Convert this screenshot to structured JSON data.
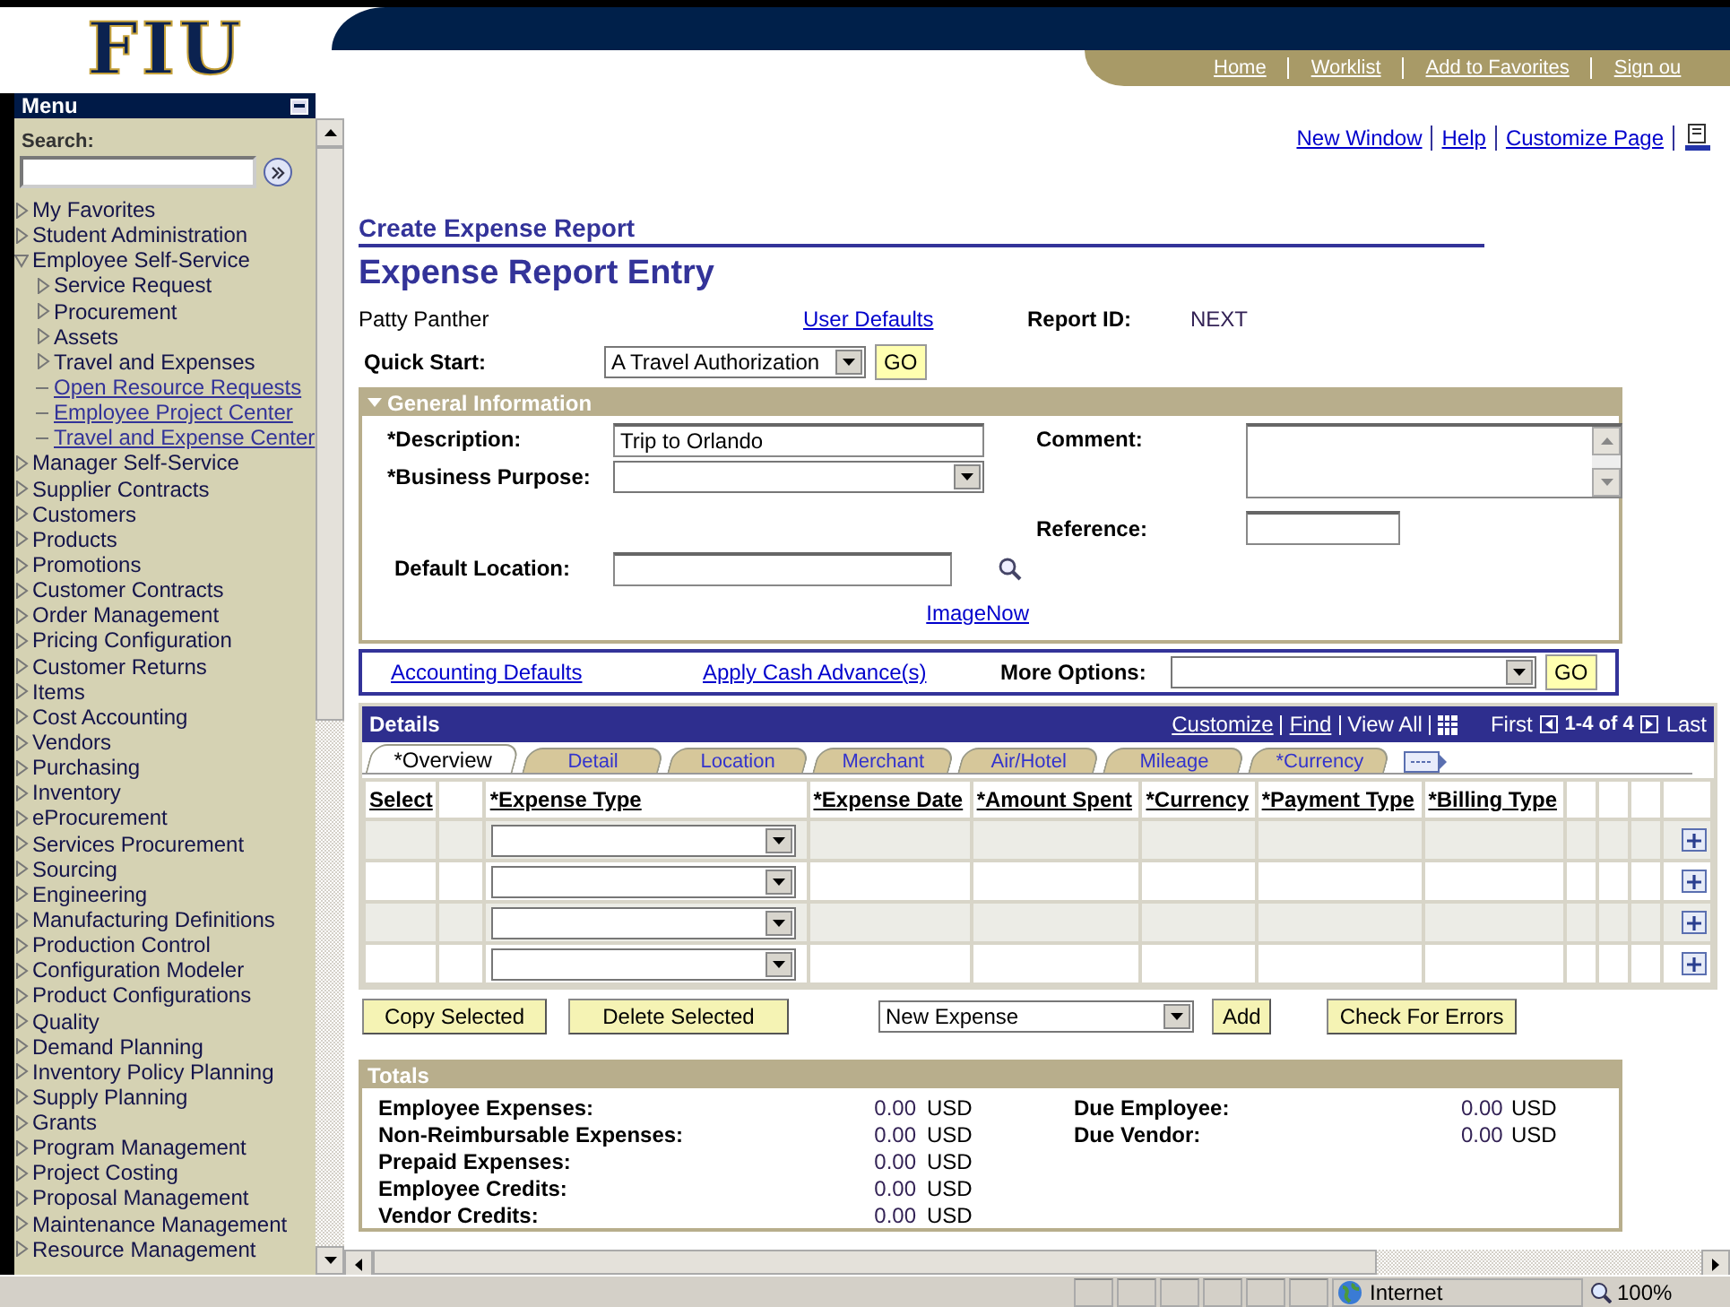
{
  "header": {
    "logo": "FIU",
    "nav_links": [
      "Home",
      "Worklist",
      "Add to Favorites",
      "Sign ou"
    ]
  },
  "sidebar": {
    "title": "Menu",
    "search_label": "Search:",
    "items": [
      {
        "label": "My Favorites",
        "kind": "folder",
        "expanded": false
      },
      {
        "label": "Student Administration",
        "kind": "folder",
        "expanded": false
      },
      {
        "label": "Employee Self-Service",
        "kind": "folder",
        "expanded": true,
        "children": [
          {
            "label": "Service Request",
            "kind": "folder",
            "expanded": false
          },
          {
            "label": "Procurement",
            "kind": "folder",
            "expanded": false
          },
          {
            "label": "Assets",
            "kind": "folder",
            "expanded": false
          },
          {
            "label": "Travel and Expenses",
            "kind": "folder",
            "expanded": false
          },
          {
            "label": "Open Resource Requests",
            "kind": "link"
          },
          {
            "label": "Employee Project Center",
            "kind": "link"
          },
          {
            "label": "Travel and Expense Center",
            "kind": "link"
          }
        ]
      },
      {
        "label": "Manager Self-Service",
        "kind": "folder",
        "expanded": false
      },
      {
        "label": "Supplier Contracts",
        "kind": "folder",
        "expanded": false
      },
      {
        "label": "Customers",
        "kind": "folder",
        "expanded": false
      },
      {
        "label": "Products",
        "kind": "folder",
        "expanded": false
      },
      {
        "label": "Promotions",
        "kind": "folder",
        "expanded": false
      },
      {
        "label": "Customer Contracts",
        "kind": "folder",
        "expanded": false
      },
      {
        "label": "Order Management",
        "kind": "folder",
        "expanded": false
      },
      {
        "label": "Pricing Configuration",
        "kind": "folder",
        "expanded": false
      },
      {
        "label": "Customer Returns",
        "kind": "folder",
        "expanded": false
      },
      {
        "label": "Items",
        "kind": "folder",
        "expanded": false
      },
      {
        "label": "Cost Accounting",
        "kind": "folder",
        "expanded": false
      },
      {
        "label": "Vendors",
        "kind": "folder",
        "expanded": false
      },
      {
        "label": "Purchasing",
        "kind": "folder",
        "expanded": false
      },
      {
        "label": "Inventory",
        "kind": "folder",
        "expanded": false
      },
      {
        "label": "eProcurement",
        "kind": "folder",
        "expanded": false
      },
      {
        "label": "Services Procurement",
        "kind": "folder",
        "expanded": false
      },
      {
        "label": "Sourcing",
        "kind": "folder",
        "expanded": false
      },
      {
        "label": "Engineering",
        "kind": "folder",
        "expanded": false
      },
      {
        "label": "Manufacturing Definitions",
        "kind": "folder",
        "expanded": false
      },
      {
        "label": "Production Control",
        "kind": "folder",
        "expanded": false
      },
      {
        "label": "Configuration Modeler",
        "kind": "folder",
        "expanded": false
      },
      {
        "label": "Product Configurations",
        "kind": "folder",
        "expanded": false
      },
      {
        "label": "Quality",
        "kind": "folder",
        "expanded": false
      },
      {
        "label": "Demand Planning",
        "kind": "folder",
        "expanded": false
      },
      {
        "label": "Inventory Policy Planning",
        "kind": "folder",
        "expanded": false
      },
      {
        "label": "Supply Planning",
        "kind": "folder",
        "expanded": false
      },
      {
        "label": "Grants",
        "kind": "folder",
        "expanded": false
      },
      {
        "label": "Program Management",
        "kind": "folder",
        "expanded": false
      },
      {
        "label": "Project Costing",
        "kind": "folder",
        "expanded": false
      },
      {
        "label": "Proposal Management",
        "kind": "folder",
        "expanded": false
      },
      {
        "label": "Maintenance Management",
        "kind": "folder",
        "expanded": false
      },
      {
        "label": "Resource Management",
        "kind": "folder",
        "expanded": false
      }
    ]
  },
  "page_links": [
    "New Window",
    "Help",
    "Customize Page"
  ],
  "breadcrumb": "Create Expense Report",
  "title": "Expense Report Entry",
  "employee": "Patty Panther",
  "user_defaults_link": "User Defaults",
  "report_id_label": "Report ID:",
  "report_id": "NEXT",
  "quick_start": {
    "label": "Quick Start:",
    "value": "A Travel Authorization",
    "button": "GO"
  },
  "general_information": {
    "title": "General Information",
    "expanded": true,
    "description": {
      "label": "*Description:",
      "value": "Trip to Orlando"
    },
    "business_purpose": {
      "label": "*Business Purpose:"
    },
    "default_location": {
      "label": "Default Location:"
    },
    "comment": {
      "label": "Comment:"
    },
    "reference": {
      "label": "Reference:"
    },
    "imagenow_link": "ImageNow"
  },
  "options_bar": {
    "links": [
      "Accounting Defaults",
      "Apply Cash Advance(s)"
    ],
    "more_options_label": "More Options:",
    "button": "GO"
  },
  "details": {
    "title": "Details",
    "links": [
      "Customize",
      "Find"
    ],
    "view_all": "View All",
    "first": "First",
    "range": "1-4 of 4",
    "last": "Last",
    "tabs": [
      {
        "label": "*Overview",
        "selected": true
      },
      {
        "label": "Detail",
        "selected": false
      },
      {
        "label": "Location",
        "selected": false
      },
      {
        "label": "Merchant",
        "selected": false
      },
      {
        "label": "Air/Hotel",
        "selected": false
      },
      {
        "label": "Mileage",
        "selected": false
      },
      {
        "label": "*Currency",
        "selected": false
      }
    ],
    "columns": [
      "Select",
      "*Expense Type",
      "*Expense Date",
      "*Amount Spent",
      "*Currency",
      "*Payment Type",
      "*Billing Type"
    ]
  },
  "actions": {
    "copy": "Copy Selected",
    "delete": "Delete Selected",
    "new_expense": "New Expense",
    "add": "Add",
    "check": "Check For Errors"
  },
  "totals": {
    "title": "Totals",
    "left": [
      {
        "label": "Employee Expenses:",
        "amount": "0.00",
        "currency": "USD"
      },
      {
        "label": "Non-Reimbursable Expenses:",
        "amount": "0.00",
        "currency": "USD"
      },
      {
        "label": "Prepaid Expenses:",
        "amount": "0.00",
        "currency": "USD"
      },
      {
        "label": "Employee Credits:",
        "amount": "0.00",
        "currency": "USD"
      },
      {
        "label": "Vendor Credits:",
        "amount": "0.00",
        "currency": "USD"
      }
    ],
    "right": [
      {
        "label": "Due Employee:",
        "amount": "0.00",
        "currency": "USD"
      },
      {
        "label": "Due Vendor:",
        "amount": "0.00",
        "currency": "USD"
      }
    ]
  },
  "status_bar": {
    "zone": "Internet",
    "zoom": "100%"
  }
}
